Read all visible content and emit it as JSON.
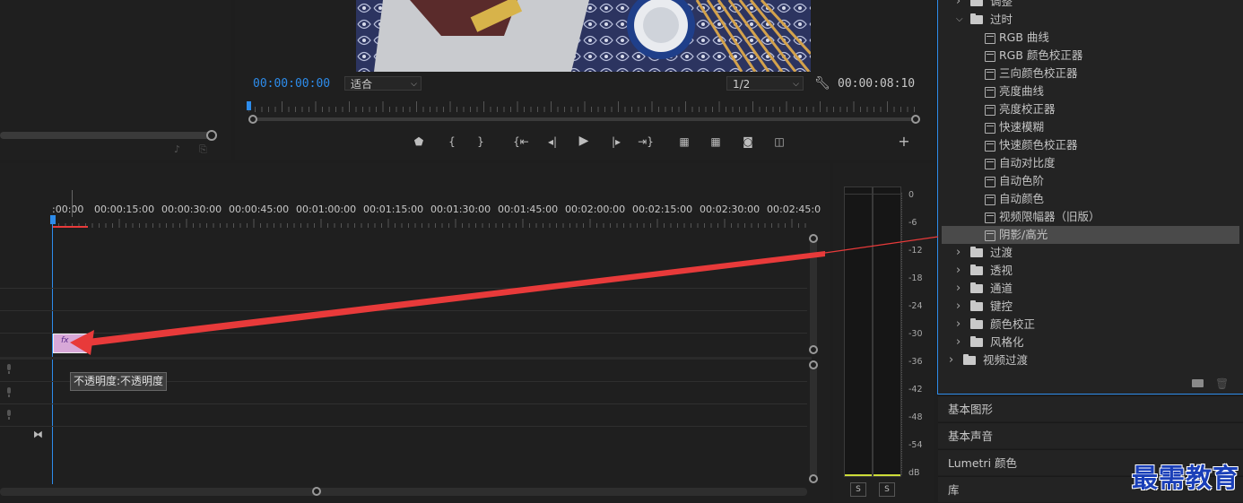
{
  "program_monitor": {
    "current_timecode": "00:00:00:00",
    "fit_select": "适合",
    "resolution_select": "1/2",
    "duration_timecode": "00:00:08:10"
  },
  "timeline": {
    "ruler_labels": [
      ":00:00",
      "00:00:15:00",
      "00:00:30:00",
      "00:00:45:00",
      "00:01:00:00",
      "00:01:15:00",
      "00:01:30:00",
      "00:01:45:00",
      "00:02:00:00",
      "00:02:15:00",
      "00:02:30:00",
      "00:02:45:0"
    ],
    "clip_label": "fx",
    "tooltip": "不透明度:不透明度"
  },
  "audio_meter": {
    "db_labels": [
      "0",
      "-6",
      "-12",
      "-18",
      "-24",
      "-30",
      "-36",
      "-42",
      "-48",
      "-54",
      "dB"
    ],
    "solo_labels": [
      "S",
      "S"
    ]
  },
  "effects_panel": {
    "rows": [
      {
        "type": "folder",
        "label": "调整",
        "expanded": false,
        "indent": 1
      },
      {
        "type": "folder",
        "label": "过时",
        "expanded": true,
        "indent": 1
      },
      {
        "type": "effect",
        "label": "RGB 曲线",
        "indent": 2
      },
      {
        "type": "effect",
        "label": "RGB 颜色校正器",
        "indent": 2
      },
      {
        "type": "effect",
        "label": "三向颜色校正器",
        "indent": 2
      },
      {
        "type": "effect",
        "label": "亮度曲线",
        "indent": 2
      },
      {
        "type": "effect",
        "label": "亮度校正器",
        "indent": 2
      },
      {
        "type": "effect",
        "label": "快速模糊",
        "indent": 2
      },
      {
        "type": "effect",
        "label": "快速颜色校正器",
        "indent": 2
      },
      {
        "type": "effect",
        "label": "自动对比度",
        "indent": 2
      },
      {
        "type": "effect",
        "label": "自动色阶",
        "indent": 2
      },
      {
        "type": "effect",
        "label": "自动颜色",
        "indent": 2
      },
      {
        "type": "effect",
        "label": "视频限幅器（旧版）",
        "indent": 2
      },
      {
        "type": "effect",
        "label": "阴影/高光",
        "indent": 2,
        "selected": true
      },
      {
        "type": "folder",
        "label": "过渡",
        "expanded": false,
        "indent": 1
      },
      {
        "type": "folder",
        "label": "透视",
        "expanded": false,
        "indent": 1
      },
      {
        "type": "folder",
        "label": "通道",
        "expanded": false,
        "indent": 1
      },
      {
        "type": "folder",
        "label": "键控",
        "expanded": false,
        "indent": 1
      },
      {
        "type": "folder",
        "label": "颜色校正",
        "expanded": false,
        "indent": 1
      },
      {
        "type": "folder",
        "label": "风格化",
        "expanded": false,
        "indent": 1
      },
      {
        "type": "folder",
        "label": "视频过渡",
        "expanded": false,
        "indent": 0
      }
    ]
  },
  "side_panels": [
    "基本图形",
    "基本声音",
    "Lumetri 颜色",
    "库"
  ],
  "watermark": "最需教育",
  "colors": {
    "accent": "#2d8ceb",
    "arrow": "#e83a3a",
    "selected_row": "#4a4a4a",
    "panel_border": "#2d8ceb",
    "watermark": "#1a3fb8"
  }
}
